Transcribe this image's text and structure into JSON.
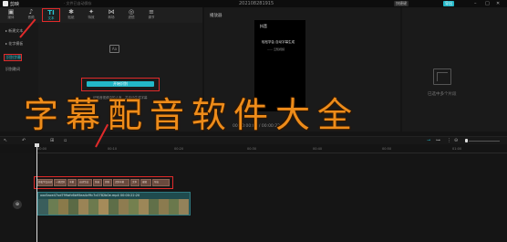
{
  "titlebar": {
    "app_name": "剪映",
    "notice": "· 文件已自动保存",
    "project_title": "202108281915",
    "shortcut_label": "快捷键",
    "export_label": "导出"
  },
  "tools": [
    {
      "icon": "▣",
      "label": "媒体"
    },
    {
      "icon": "♪",
      "label": "音频"
    },
    {
      "icon": "TI",
      "label": "文本"
    },
    {
      "icon": "✱",
      "label": "贴纸"
    },
    {
      "icon": "✦",
      "label": "特效"
    },
    {
      "icon": "⋈",
      "label": "转场"
    },
    {
      "icon": "◎",
      "label": "滤镜"
    },
    {
      "icon": "≡",
      "label": "调节"
    }
  ],
  "sidebar": {
    "items": [
      "▸ 新建文本",
      "▸ 花字模板",
      "识别字幕",
      "识别歌词"
    ]
  },
  "drop_area": {
    "ai_icon_text": "Aa",
    "recognize_button": "开始识别",
    "hint": "识别音视频中的人声，并自动生成字幕"
  },
  "player": {
    "title": "播放器",
    "tiktok": "抖音",
    "video_text1": "轻松学会 自动字幕生成",
    "video_text2": "—— 云知视频",
    "time": "00:00:00:00 / 00:00:22:20"
  },
  "props": {
    "hint": "已选中多个片段"
  },
  "overlay": {
    "headline": "字幕配音软件大全"
  },
  "timeline": {
    "ticks": [
      "00:00",
      "00:10",
      "00:20",
      "00:30",
      "00:40",
      "00:50",
      "01:00"
    ],
    "subtitle_clips": [
      "轻松学会自动字幕",
      "一键识别",
      "字幕",
      "自动生成",
      "快速",
      "剪映",
      "识别字幕",
      "文本",
      "编辑",
      "导出"
    ],
    "video_label": "xxx5ace47xd799afc6b95ea4cf9c7c0782b0e.mp4  00:00:22:20",
    "add_track": "⊕"
  },
  "colors": {
    "accent": "#23b8c8",
    "annotation_red": "#e02a2a",
    "headline_orange": "#ee8c1a"
  }
}
